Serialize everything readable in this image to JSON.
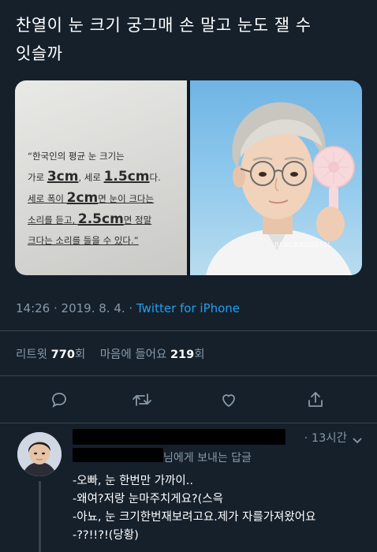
{
  "tweet": {
    "text_line1": "찬열이 눈 크기 궁그매 손 말고 눈도 잴 수",
    "text_line2": "잇슬까",
    "media": {
      "quote_line1": "“한국인의 평균 눈 크기는",
      "quote_line2_a": "가로 ",
      "quote_line2_b": "3cm",
      "quote_line2_c": ", 세로 ",
      "quote_line2_d": "1.5cm",
      "quote_line2_e": "다.",
      "quote_line3_a": "세로 폭이 ",
      "quote_line3_b": "2cm",
      "quote_line3_c": "면 눈이 크다는",
      "quote_line4_a": "소리를 듣고, ",
      "quote_line4_b": "2.5cm",
      "quote_line4_c": "면 정말",
      "quote_line5": "크다는 소리를 들을 수 있다.”",
      "watermark": "BLACKROSEVIL"
    },
    "time": "14:26",
    "sep": " · ",
    "date": "2019. 8. 4.",
    "sep2": " · ",
    "client": "Twitter for iPhone",
    "retweet_label": "리트윗 ",
    "retweet_count": "770",
    "retweet_unit": "회",
    "like_label": "마음에 들어요 ",
    "like_count": "219",
    "like_unit": "회"
  },
  "actions": {
    "icons": [
      "reply-icon",
      "retweet-icon",
      "like-icon",
      "share-icon"
    ]
  },
  "reply": {
    "time": "· 13시간",
    "to_suffix": "님에게 보내는 답글",
    "lines": [
      "-오빠, 눈 한번만 가까이..",
      "-왜여?저랑 눈마주치게요?(스윽",
      "-아뇨, 눈 크기한번재보려고요.제가 자를가져왔어요",
      "-??!!?!(당황)"
    ]
  },
  "colors": {
    "background": "#15202b",
    "secondary_text": "#8899a6",
    "link": "#1da1f2",
    "divider": "#38444d"
  }
}
